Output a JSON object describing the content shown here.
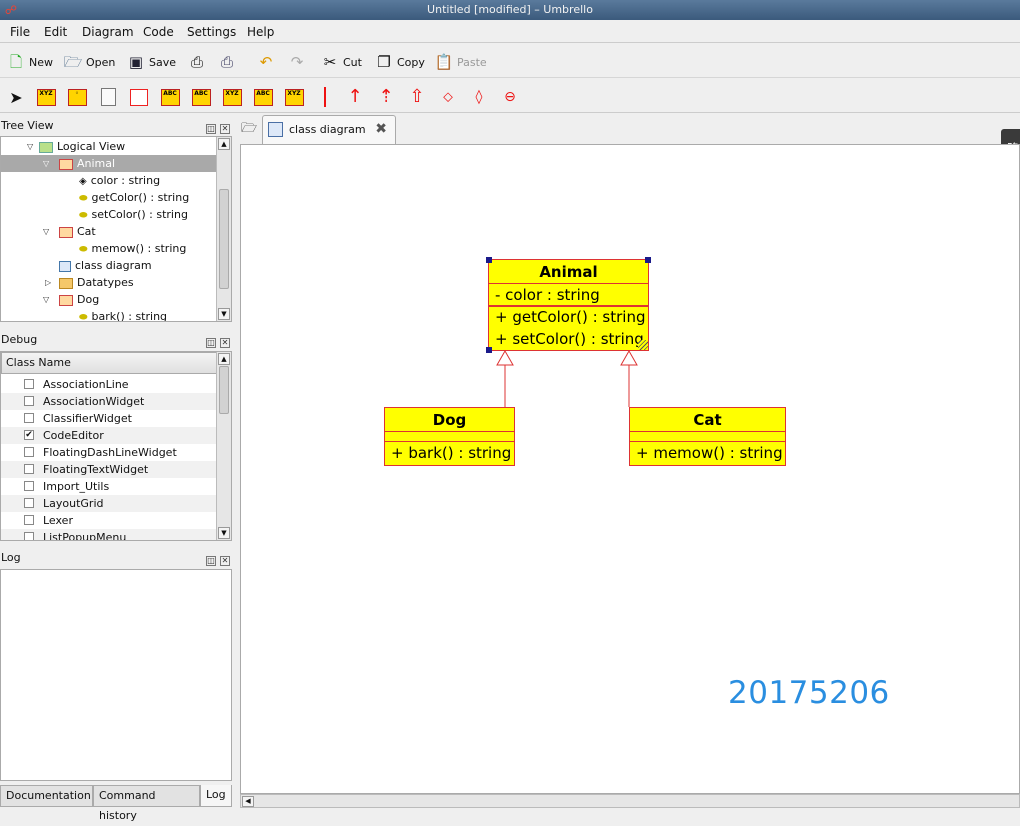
{
  "window": {
    "title": "Untitled [modified] – Umbrello"
  },
  "menu": [
    "File",
    "Edit",
    "Diagram",
    "Code",
    "Settings",
    "Help"
  ],
  "toolbar": {
    "new": "New",
    "open": "Open",
    "save": "Save",
    "cut": "Cut",
    "copy": "Copy",
    "paste": "Paste"
  },
  "diagram_tools": [
    "arrow-select-icon",
    "class-tool-icon",
    "interface-tool-icon",
    "note-tool-icon",
    "box-tool-icon",
    "datatype-tool-icon",
    "enum-tool-icon",
    "package-tool-icon",
    "component-tool-icon",
    "object-tool-icon",
    "association-tool-icon",
    "directional-assoc-icon",
    "dependency-icon",
    "generalization-icon",
    "aggregation-icon",
    "composition-icon",
    "containment-icon"
  ],
  "tree_view": {
    "title": "Tree View",
    "items": [
      {
        "label": "Logical View",
        "level": 1,
        "expanded": true,
        "icon": "folder-icon"
      },
      {
        "label": "Animal",
        "level": 2,
        "expanded": true,
        "icon": "class-icon",
        "selected": true
      },
      {
        "label": "color : string",
        "level": 3,
        "icon": "attribute-icon"
      },
      {
        "label": "getColor() : string",
        "level": 3,
        "icon": "operation-icon"
      },
      {
        "label": "setColor() : string",
        "level": 3,
        "icon": "operation-icon"
      },
      {
        "label": "Cat",
        "level": 2,
        "expanded": true,
        "icon": "class-icon"
      },
      {
        "label": "memow() : string",
        "level": 3,
        "icon": "operation-icon"
      },
      {
        "label": "class diagram",
        "level": 2,
        "icon": "diagram-icon"
      },
      {
        "label": "Datatypes",
        "level": 2,
        "expanded": false,
        "icon": "folder-icon"
      },
      {
        "label": "Dog",
        "level": 2,
        "expanded": true,
        "icon": "class-icon"
      },
      {
        "label": "bark() : string",
        "level": 3,
        "icon": "operation-icon"
      }
    ]
  },
  "debug": {
    "title": "Debug",
    "column": "Class Name",
    "items": [
      {
        "label": "AssociationLine",
        "checked": false
      },
      {
        "label": "AssociationWidget",
        "checked": false
      },
      {
        "label": "ClassifierWidget",
        "checked": false
      },
      {
        "label": "CodeEditor",
        "checked": true
      },
      {
        "label": "FloatingDashLineWidget",
        "checked": false
      },
      {
        "label": "FloatingTextWidget",
        "checked": false
      },
      {
        "label": "Import_Utils",
        "checked": false
      },
      {
        "label": "LayoutGrid",
        "checked": false
      },
      {
        "label": "Lexer",
        "checked": false
      },
      {
        "label": "ListPopupMenu",
        "checked": false
      }
    ]
  },
  "log": {
    "title": "Log"
  },
  "bottom_tabs": [
    "Documentation",
    "Command history",
    "Log"
  ],
  "diagram_tab": {
    "label": "class diagram"
  },
  "side_toolbar": {
    "label": "隐藏工具栏"
  },
  "classes": {
    "animal": {
      "name": "Animal",
      "attributes": [
        "- color : string"
      ],
      "operations": [
        "+ getColor() : string",
        "+ setColor() : string"
      ]
    },
    "dog": {
      "name": "Dog",
      "attributes": [],
      "operations": [
        "+ bark() : string"
      ]
    },
    "cat": {
      "name": "Cat",
      "attributes": [],
      "operations": [
        "+ memow() : string"
      ]
    }
  },
  "stamp": "20175206",
  "colors": {
    "class_fill": "#ffff00",
    "class_border": "#dd3333",
    "stamp": "#2a8ee0",
    "selection": "#a9a9a9"
  }
}
